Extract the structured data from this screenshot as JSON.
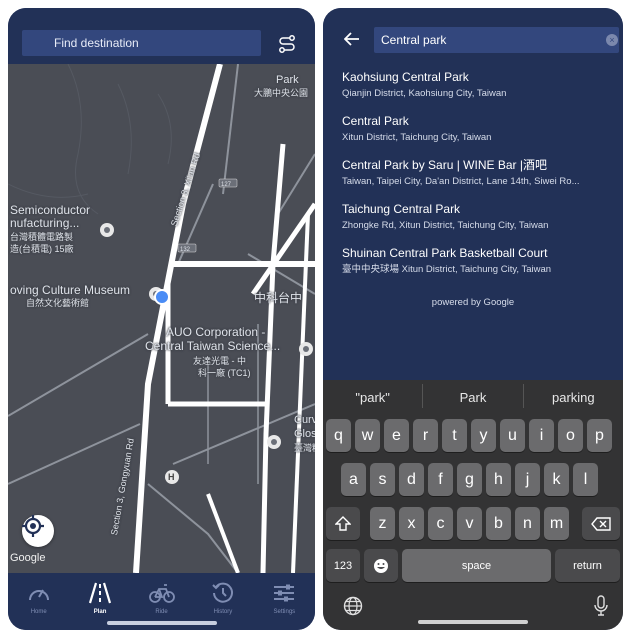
{
  "left_phone": {
    "search_placeholder": "Find destination",
    "map_labels": {
      "park": "Park",
      "park_cn": "大鵬中央公園",
      "semiconductor_1": "Semiconductor",
      "semiconductor_2": "nufacturing...",
      "semiconductor_cn1": "台灣積體電路製",
      "semiconductor_cn2": "造(台積電) 15廠",
      "museum": "oving Culture Museum",
      "museum_cn": "自然文化藝術館",
      "auo_1": "AUO Corporation -",
      "auo_2": "Central Taiwan Science...",
      "auo_cn1": "友達光電 - 中",
      "auo_cn2": "科一廠 (TC1)",
      "science_park_cn": "中科台中",
      "road_1": "Section 3, Xi'an Rd",
      "road_2": "Section 3, Gongyuan Rd",
      "curve_1": "Curv",
      "curve_2": "Glos",
      "curve_cn": "臺灣糖",
      "hospital": "H",
      "shield_1": "127",
      "shield_2": "132"
    },
    "google_logo": "Google",
    "nav": [
      {
        "label": "Home",
        "icon": "gauge-icon"
      },
      {
        "label": "Plan",
        "icon": "road-icon"
      },
      {
        "label": "Ride",
        "icon": "bicycle-icon"
      },
      {
        "label": "History",
        "icon": "history-icon"
      },
      {
        "label": "Settings",
        "icon": "sliders-icon"
      }
    ]
  },
  "right_phone": {
    "search_value": "Central park",
    "results": [
      {
        "name": "Kaohsiung Central Park",
        "address": "Qianjin District, Kaohsiung City, Taiwan"
      },
      {
        "name": "Central Park",
        "address": "Xitun District, Taichung City, Taiwan"
      },
      {
        "name": "Central Park by Saru | WINE Bar |酒吧",
        "address": "Taiwan, Taipei City, Da'an District, Lane 14th, Siwei Ro..."
      },
      {
        "name": "Taichung Central Park",
        "address": "Zhongke Rd, Xitun District, Taichung City, Taiwan"
      },
      {
        "name": "Shuinan Central Park Basketball Court",
        "address": "臺中中央球場 Xitun District, Taichung City, Taiwan"
      }
    ],
    "powered_by": "powered by Google",
    "keyboard": {
      "suggestions": [
        "\"park\"",
        "Park",
        "parking"
      ],
      "row1": [
        "q",
        "w",
        "e",
        "r",
        "t",
        "y",
        "u",
        "i",
        "o",
        "p"
      ],
      "row2": [
        "a",
        "s",
        "d",
        "f",
        "g",
        "h",
        "j",
        "k",
        "l"
      ],
      "row3": [
        "z",
        "x",
        "c",
        "v",
        "b",
        "n",
        "m"
      ],
      "numbers_key": "123",
      "space_key": "space",
      "return_key": "return"
    }
  },
  "colors": {
    "navy": "#223157",
    "search_field": "#33477d",
    "map_bg": "#4a4d55",
    "road": "#ffffff",
    "keyboard_bg": "#333334",
    "key": "#6b6b6d"
  }
}
